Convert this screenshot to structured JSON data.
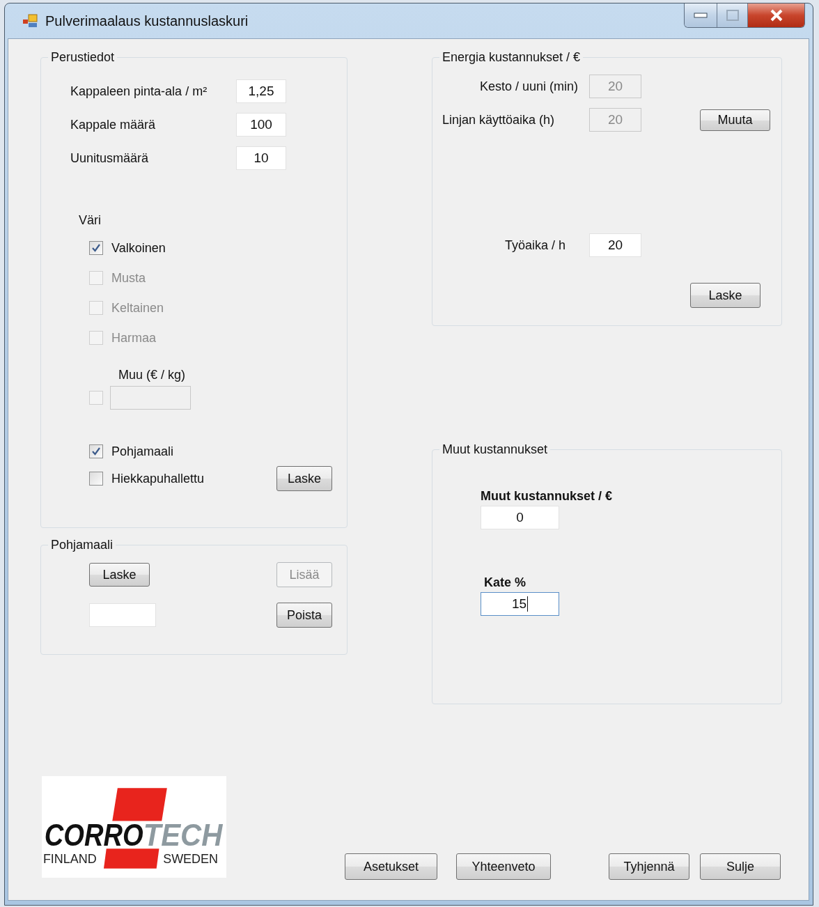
{
  "window": {
    "title": "Pulverimaalaus kustannuslaskuri"
  },
  "basic": {
    "title": "Perustiedot",
    "fields": [
      {
        "label": "Kappaleen pinta-ala / m²",
        "value": "1,25"
      },
      {
        "label": "Kappale määrä",
        "value": "100"
      },
      {
        "label": "Uunitusmäärä",
        "value": "10"
      }
    ],
    "color_heading": "Väri",
    "colors": [
      {
        "label": "Valkoinen",
        "checked": true,
        "disabled": false
      },
      {
        "label": "Musta",
        "checked": false,
        "disabled": true
      },
      {
        "label": "Keltainen",
        "checked": false,
        "disabled": true
      },
      {
        "label": "Harmaa",
        "checked": false,
        "disabled": true
      }
    ],
    "other": {
      "label": "Muu (€ / kg)",
      "checked": false,
      "disabled": true
    },
    "options": [
      {
        "label": "Pohjamaali",
        "checked": true
      },
      {
        "label": "Hiekkapuhallettu",
        "checked": false
      }
    ],
    "button": "Laske"
  },
  "primer": {
    "title": "Pohjamaali",
    "calc_button": "Laske",
    "add_button": {
      "label": "Lisää",
      "disabled": true
    },
    "remove_button": {
      "label": "Poista",
      "disabled": false
    }
  },
  "energy": {
    "title": "Energia kustannukset / €",
    "fields": [
      {
        "label": "Kesto / uuni (min)",
        "value": "20",
        "disabled": true
      },
      {
        "label": "Linjan käyttöaika (h)",
        "value": "20",
        "disabled": true
      }
    ],
    "change_button": "Muuta",
    "work": {
      "label": "Työaika / h",
      "value": "20"
    },
    "button": "Laske"
  },
  "other_costs": {
    "title": "Muut kustannukset",
    "fields": [
      {
        "label": "Muut kustannukset / €",
        "value": "0",
        "focused": false
      },
      {
        "label": "Kate %",
        "value": "15",
        "focused": true
      }
    ]
  },
  "logo": {
    "name_dark": "CORRO",
    "name_light": "TECH",
    "left": "FINLAND",
    "right": "SWEDEN"
  },
  "footer_buttons": [
    {
      "label": "Asetukset",
      "kind": "left"
    },
    {
      "label": "Yhteenveto",
      "kind": "left"
    },
    {
      "label": "Tyhjennä",
      "kind": "right"
    },
    {
      "label": "Sulje",
      "kind": "right"
    }
  ]
}
